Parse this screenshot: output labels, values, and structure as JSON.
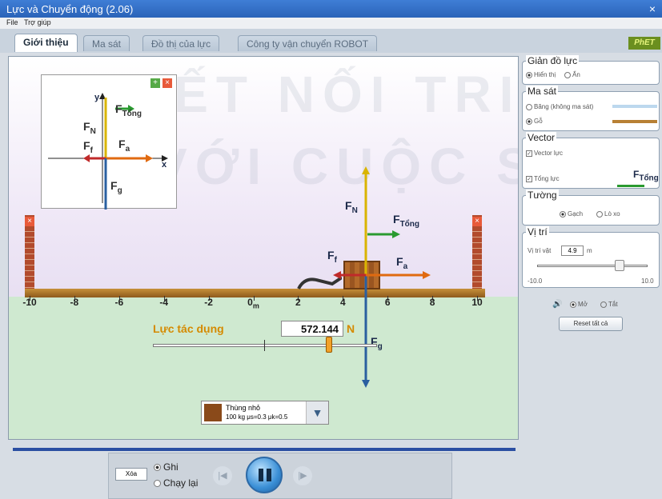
{
  "window": {
    "title": "Lực và Chuyển động (2.06)",
    "close": "×"
  },
  "menu": {
    "file": "File",
    "help": "Trợ giúp"
  },
  "tabs": [
    {
      "label": "Giới thiệu",
      "active": true
    },
    {
      "label": "Ma sát",
      "active": false
    },
    {
      "label": "Đồ thị của lực",
      "active": false
    },
    {
      "label": "Công ty vận chuyển ROBOT",
      "active": false
    }
  ],
  "logo": "PhET",
  "watermark": {
    "line1": "KẾT NỐI TRI THỨC",
    "line2": "VỚI CUỘC SỐNG"
  },
  "free_body": {
    "y_axis": "y",
    "x_axis": "x",
    "fn": "N",
    "ftotal": "Tổng",
    "ff": "f",
    "fa": "a",
    "fg": "g",
    "f": "F"
  },
  "scene": {
    "ticks": [
      "-10",
      "-8",
      "-6",
      "-4",
      "-2",
      "0",
      "2",
      "4",
      "6",
      "8",
      "10"
    ],
    "zero_unit": "m",
    "force_labels": {
      "fn_sub": "N",
      "ftotal_sub": "Tổng",
      "ff_sub": "f",
      "fa_sub": "a",
      "fg_sub": "g",
      "f": "F"
    },
    "applied_force_label": "Lực tác dụng",
    "applied_force_value": "572.144",
    "applied_force_unit": "N",
    "object_name": "Thùng nhỏ",
    "object_props": "100 kg μs=0.3 μk=0.5",
    "dropdown_arrow": "▼",
    "wall_close": "×"
  },
  "panel": {
    "diagram": {
      "title": "Giản đồ lực",
      "show": "Hiển thị",
      "hide": "Ẩn"
    },
    "friction": {
      "title": "Ma sát",
      "ice": "Băng (không ma sát)",
      "wood": "Gỗ"
    },
    "vector": {
      "title": "Vector",
      "force": "Vector lực",
      "sum": "Tổng lực",
      "sum_label": "Tổng",
      "sum_f": "F"
    },
    "wall": {
      "title": "Tường",
      "brick": "Gạch",
      "spring": "Lò xo"
    },
    "position": {
      "title": "Vị trí",
      "label": "Vị trí vật",
      "value": "4.9",
      "unit": "m",
      "min": "-10.0",
      "max": "10.0",
      "level": 0.745
    },
    "sound": {
      "on": "Mở",
      "off": "Tắt"
    },
    "reset": "Reset tất cả"
  },
  "playback": {
    "clear": "Xóa",
    "record": "Ghi",
    "replay": "Chạy lại"
  },
  "colors": {
    "accent": "#2b4fa2",
    "applied": "#d58a00",
    "ground": "#cfe9d0"
  }
}
